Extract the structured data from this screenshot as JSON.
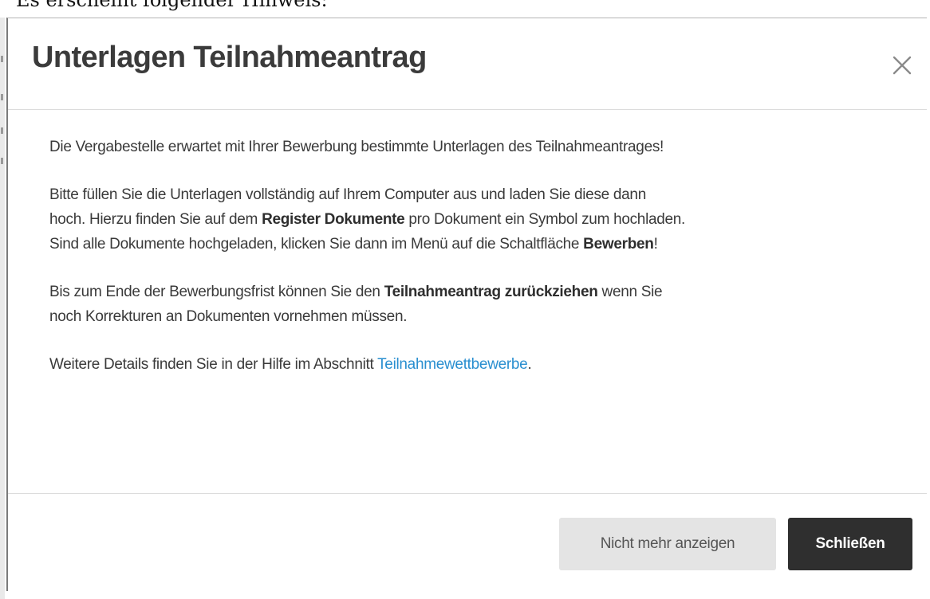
{
  "document": {
    "intro_line": "Es erscheint folgender Hinweis:"
  },
  "dialog": {
    "title": "Unterlagen Teilnahmeantrag",
    "close_icon": "close-icon",
    "body": {
      "p1": "Die Vergabestelle erwartet mit Ihrer Bewerbung bestimmte Unterlagen des Teilnahmeantrages!",
      "p2_line1": "Bitte füllen Sie die Unterlagen vollständig auf Ihrem Computer aus und laden Sie diese dann",
      "p2_line2_a": "hoch. Hierzu finden Sie auf dem ",
      "p2_line2_bold": "Register Dokumente",
      "p2_line2_b": " pro Dokument ein Symbol zum hochladen.",
      "p2_line3_a": "Sind alle Dokumente hochgeladen, klicken Sie dann im Menü auf die Schaltfläche ",
      "p2_line3_bold": "Bewerben",
      "p2_line3_b": "!",
      "p3_line1_a": "Bis zum Ende der Bewerbungsfrist können Sie den ",
      "p3_line1_bold": "Teilnahmeantrag zurückziehen",
      "p3_line1_b": " wenn Sie",
      "p3_line2": "noch Korrekturen an Dokumenten vornehmen müssen.",
      "p4_a": "Weitere Details finden Sie in der Hilfe im Abschnitt ",
      "p4_link": "Teilnahmewettbewerbe",
      "p4_b": "."
    },
    "footer": {
      "dont_show_label": "Nicht mehr anzeigen",
      "close_label": "Schließen"
    }
  },
  "colors": {
    "link": "#2a8fd0",
    "primary_button": "#2f2f2f",
    "secondary_button": "#e4e4e4",
    "title_text": "#3b3b3b"
  }
}
